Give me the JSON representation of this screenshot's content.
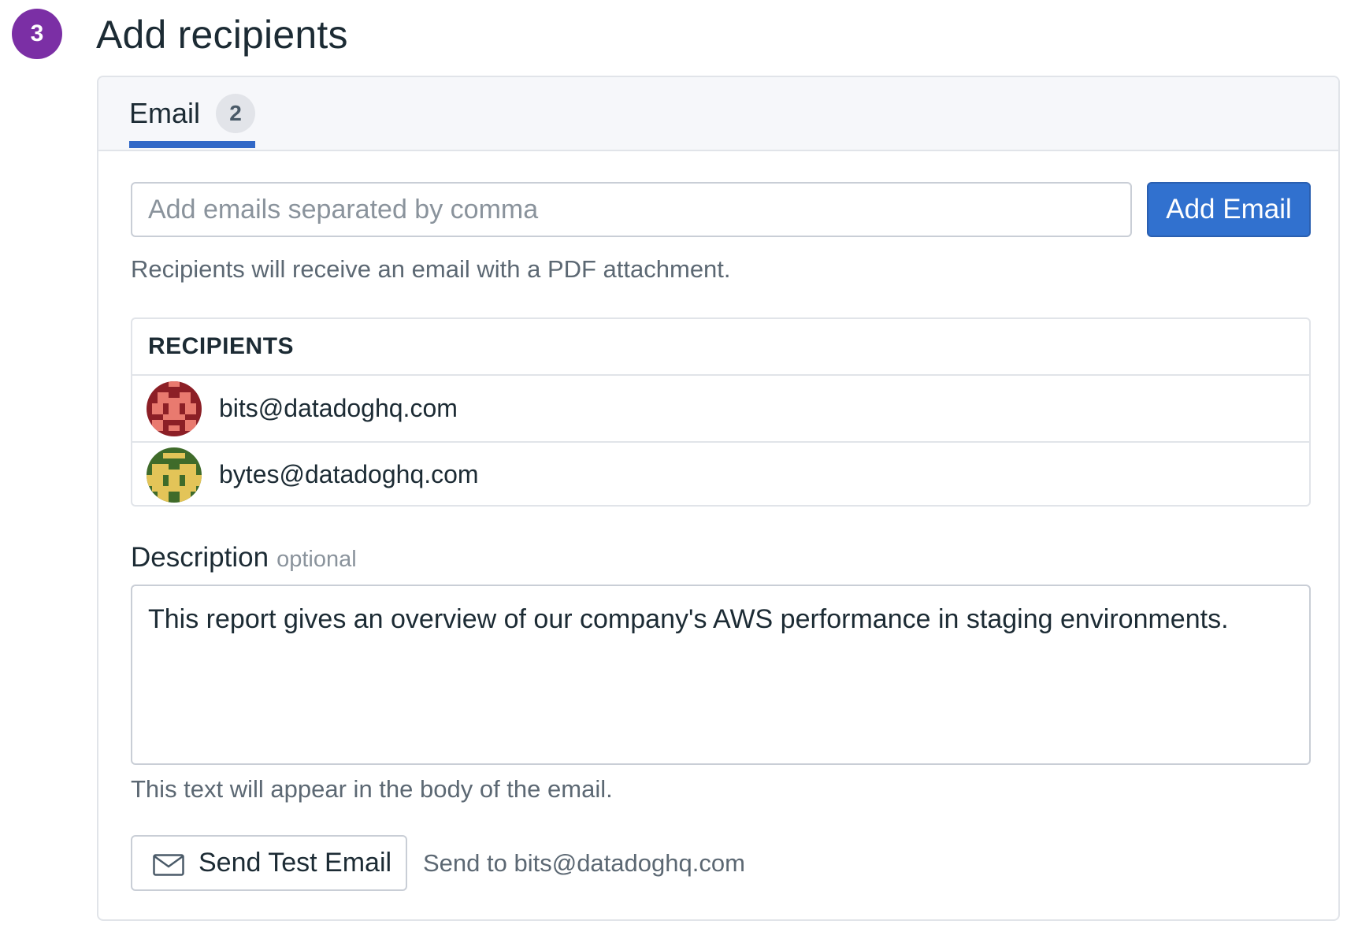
{
  "step": {
    "number": "3",
    "title": "Add recipients"
  },
  "tabs": [
    {
      "label": "Email",
      "count": "2",
      "selected": true
    }
  ],
  "email_input": {
    "placeholder": "Add emails separated by comma",
    "value": ""
  },
  "add_email_button": {
    "label": "Add Email"
  },
  "helper_text": "Recipients will receive an email with a PDF attachment.",
  "recipients": {
    "header": "RECIPIENTS",
    "items": [
      {
        "email": "bits@datadoghq.com",
        "avatar_icon": "pixel-avatar-red"
      },
      {
        "email": "bytes@datadoghq.com",
        "avatar_icon": "pixel-avatar-green"
      }
    ]
  },
  "description": {
    "label": "Description",
    "optional_label": "optional",
    "value": "This report gives an overview of our company's AWS performance in staging environments.",
    "helper": "This text will appear in the body of the email."
  },
  "send_test": {
    "button_label": "Send Test Email",
    "icon": "envelope-icon",
    "send_to_text": "Send to bits@datadoghq.com"
  },
  "colors": {
    "step_badge": "#7b2fa5",
    "primary": "#3171cf",
    "tab_underline": "#3168c7",
    "avatar_red_bg": "#8c1f26",
    "avatar_red_fg": "#e97a6f",
    "avatar_green_bg": "#3f6b2a",
    "avatar_green_fg": "#e3c458"
  }
}
